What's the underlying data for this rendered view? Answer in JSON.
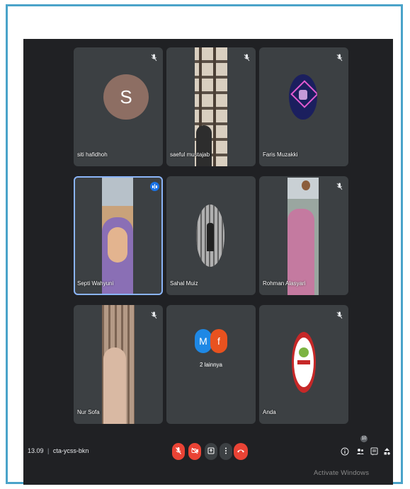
{
  "participants": [
    {
      "name": "siti hafidhoh",
      "avatar_letter": "S",
      "avatar_color": "#8d6e63",
      "muted": true
    },
    {
      "name": "saeful mustajab",
      "muted": true
    },
    {
      "name": "Faris Muzakki",
      "muted": true
    },
    {
      "name": "Septi Wahyuni",
      "speaking": true
    },
    {
      "name": "Sahal Muiz"
    },
    {
      "name": "Rohman Alasyari",
      "muted": true
    },
    {
      "name": "Nur Sofa",
      "muted": true
    },
    {
      "name": "2 lainnya",
      "others": [
        "M",
        "f"
      ]
    },
    {
      "name": "Anda",
      "muted": true
    }
  ],
  "bottom_bar": {
    "time": "13.09",
    "separator": "|",
    "meeting_code": "cta-ycss-bkn",
    "people_count": "10",
    "icons": [
      "mic-off-icon",
      "camera-off-icon",
      "present-icon",
      "more-icon",
      "end-call-icon",
      "info-icon",
      "people-icon",
      "chat-icon",
      "activities-icon"
    ]
  },
  "watermark": "Activate Windows",
  "colors": {
    "background": "#202124",
    "tile": "#3c4043",
    "red": "#ea4335",
    "blue": "#1a73e8",
    "frame": "#4aa3c9"
  }
}
